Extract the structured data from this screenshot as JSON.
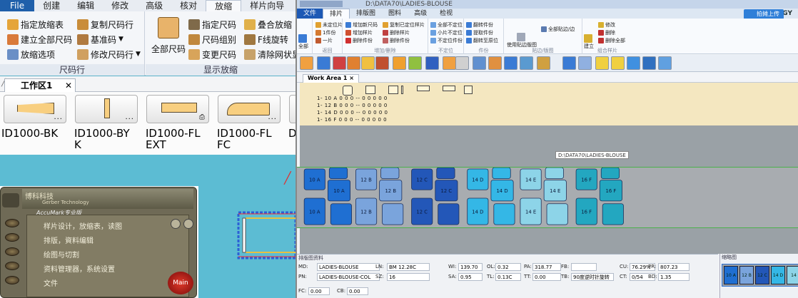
{
  "left_app": {
    "menu": [
      "File",
      "创建",
      "编辑",
      "修改",
      "高级",
      "核对",
      "放缩",
      "样片向导"
    ],
    "active_menu": "放缩",
    "ribbon": {
      "group1": {
        "title": "尺码行",
        "items": [
          "指定放缩表",
          "建立全部尺码",
          "放缩选项",
          "复制尺码行",
          "基准码",
          "修改尺码行"
        ]
      },
      "group2": {
        "title": "显示放缩",
        "items": [
          "全部尺码",
          "指定尺码",
          "尺码组别",
          "变更尺码",
          "叠合放缩",
          "F线旋转",
          "清除网状显"
        ]
      }
    },
    "workarea_tab": "工作区1",
    "workarea_close": "✕",
    "thumbnails": [
      {
        "label": "ID1000-BK",
        "label2": ""
      },
      {
        "label": "ID1000-BY",
        "label2": "K"
      },
      {
        "label": "ID1000-FL",
        "label2": "EXT"
      },
      {
        "label": "ID1000-FL",
        "label2": "FC"
      },
      {
        "label": "D",
        "label2": ""
      }
    ],
    "popup": {
      "brand": "博科科技",
      "brand_sub": "Gerber Technology",
      "subtitle": "AccuMark专业版",
      "items": [
        "样片设计，放缩表，读图",
        "排版，資料编辑",
        "绘图与切割",
        "资料管理器，系统设置",
        "文件"
      ],
      "main_button": "Main"
    }
  },
  "right_app": {
    "title_path": "D:\\DATA70\\LADIES-BLOUSE",
    "menu": [
      "文件",
      "排片",
      "排版图",
      "图料",
      "高级",
      "检视"
    ],
    "active_menu": "排片",
    "upload_label": "拍摊上传",
    "brand": "G   NOLOGY",
    "ribbon_groups": [
      {
        "title": "",
        "items": [
          "全部"
        ]
      },
      {
        "title": "返回",
        "items": [
          "未定位片",
          "1件份",
          "一片"
        ]
      },
      {
        "title": "增加/删除",
        "items": [
          "增加新尺码",
          "增加样片",
          "删除件份",
          "复制已定位样片",
          "删除样片",
          "删除件份"
        ]
      },
      {
        "title": "不定位",
        "items": [
          "全部不定位",
          "小片不定位",
          "不定位件份"
        ]
      },
      {
        "title": "件份",
        "items": [
          "翻转件份",
          "提取件份",
          "翻转至原位"
        ]
      },
      {
        "title": "",
        "items": [
          "使用贴边版图"
        ]
      },
      {
        "title": "贴边/版图",
        "items": [
          "全部贴边/边"
        ]
      },
      {
        "title": "组合样片",
        "items": [
          "建立",
          "修改",
          "删除",
          "删除全部"
        ]
      }
    ],
    "workarea_tab": "Work Area 1",
    "piece_rows": [
      {
        "size": "1- 10",
        "code": "A",
        "vals": "0   0   0   --   0   0   0   0   0"
      },
      {
        "size": "1- 12",
        "code": "B",
        "vals": "0   0   0   --   0   0   0   0   0"
      },
      {
        "size": "1- 14",
        "code": "D",
        "vals": "0   0   0   --   0   0   0   0   0"
      },
      {
        "size": "1- 16",
        "code": "F",
        "vals": "0   0   0   --   0   0   0   0   0"
      }
    ],
    "tooltip": "D:\\DATA70\\LADIES-BLOUSE",
    "marker_pieces": [
      {
        "label": "10 A",
        "group": "a"
      },
      {
        "label": "10 A",
        "group": "a"
      },
      {
        "label": "10 A",
        "group": "a"
      },
      {
        "label": "10 A",
        "group": "a"
      },
      {
        "label": "10 A",
        "group": "a"
      },
      {
        "label": "12 B",
        "group": "b"
      },
      {
        "label": "12 B",
        "group": "b"
      },
      {
        "label": "12 B",
        "group": "b"
      },
      {
        "label": "12 B",
        "group": "b"
      },
      {
        "label": "12 B",
        "group": "b"
      },
      {
        "label": "12 C",
        "group": "c"
      },
      {
        "label": "12 C",
        "group": "c"
      },
      {
        "label": "12 C",
        "group": "c"
      },
      {
        "label": "12 C",
        "group": "c"
      },
      {
        "label": "12 C",
        "group": "c"
      },
      {
        "label": "14 D",
        "group": "d"
      },
      {
        "label": "14 D",
        "group": "d"
      },
      {
        "label": "14 D",
        "group": "d"
      },
      {
        "label": "14 D",
        "group": "d"
      },
      {
        "label": "14 D",
        "group": "d"
      },
      {
        "label": "14 E",
        "group": "e"
      },
      {
        "label": "14 E",
        "group": "e"
      },
      {
        "label": "14 E",
        "group": "e"
      },
      {
        "label": "14 E",
        "group": "e"
      },
      {
        "label": "14 E",
        "group": "e"
      },
      {
        "label": "16 F",
        "group": "f"
      },
      {
        "label": "16 F",
        "group": "f"
      },
      {
        "label": "16 F",
        "group": "f"
      },
      {
        "label": "16 F",
        "group": "f"
      },
      {
        "label": "16 F",
        "group": "f"
      }
    ],
    "prop_panel": {
      "title": "排版图资料",
      "fields": [
        {
          "k": "MD:",
          "v": "LADIES-BLOUSE"
        },
        {
          "k": "PN:",
          "v": "LADIES-BLOUSE-COL"
        },
        {
          "k": "LN:",
          "v": "BM 12.28C"
        },
        {
          "k": "SZ:",
          "v": "16"
        },
        {
          "k": "WI:",
          "v": "139.70"
        },
        {
          "k": "SA:",
          "v": "0.95"
        },
        {
          "k": "OL:",
          "v": "0.32"
        },
        {
          "k": "TL:",
          "v": "0.13C"
        },
        {
          "k": "PA:",
          "v": "318.77"
        },
        {
          "k": "TT:",
          "v": "0.00"
        },
        {
          "k": "FB:",
          "v": ""
        },
        {
          "k": "TB:",
          "v": "90度逆时针旋转"
        },
        {
          "k": "CU:",
          "v": "76.29%"
        },
        {
          "k": "CT:",
          "v": "0/54"
        },
        {
          "k": "PR:",
          "v": "807.23"
        },
        {
          "k": "BD:",
          "v": "1.35"
        },
        {
          "k": "FC:",
          "v": "0.00"
        },
        {
          "k": "CB:",
          "v": "0.00"
        }
      ]
    },
    "overview": {
      "title": "缩略图",
      "labels": [
        "10 A",
        "12 B",
        "12 C",
        "14 D",
        "14"
      ]
    },
    "colors": {
      "a": "#1f6fd2",
      "b": "#7aa4dc",
      "c": "#2357b8",
      "d": "#34b7e6",
      "e": "#8dd4e8",
      "f": "#23a7c0"
    }
  }
}
